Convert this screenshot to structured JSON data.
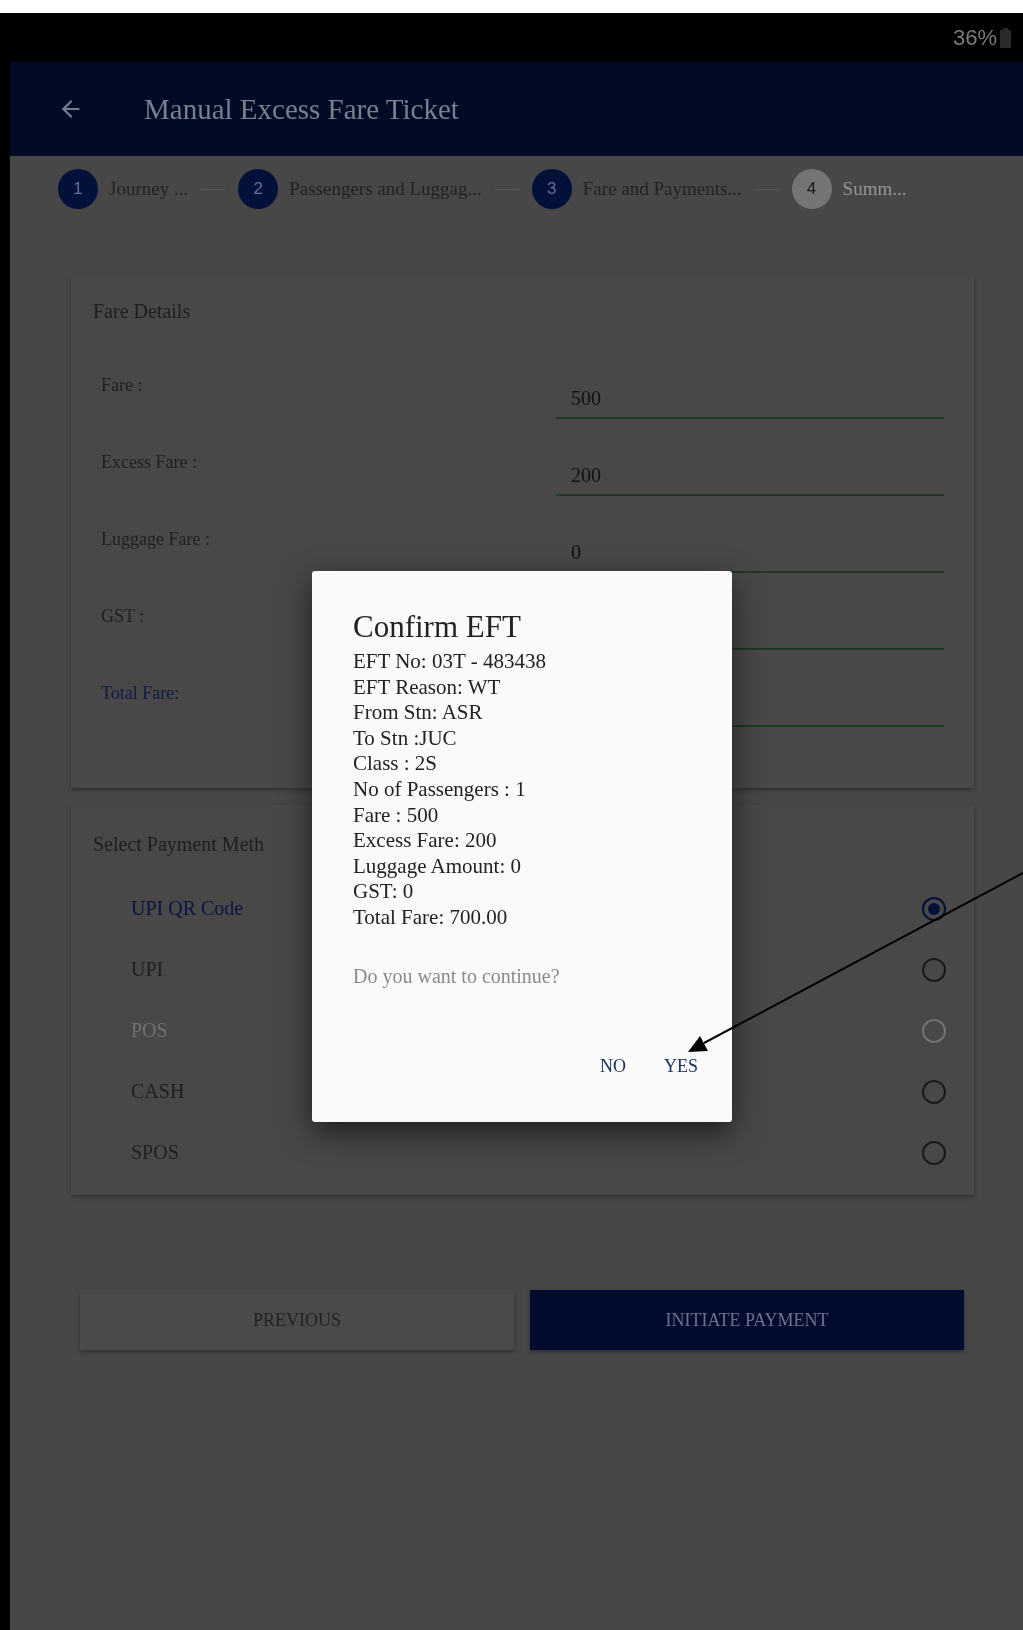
{
  "status_bar": {
    "battery": "36%"
  },
  "app_bar": {
    "title": "Manual Excess Fare Ticket"
  },
  "steps": [
    {
      "number": "1",
      "label": "Journey ...",
      "active": true
    },
    {
      "number": "2",
      "label": "Passengers and Luggag...",
      "active": true
    },
    {
      "number": "3",
      "label": "Fare and Payments...",
      "active": true
    },
    {
      "number": "4",
      "label": "Summ...",
      "active": false
    }
  ],
  "fare_details": {
    "title": "Fare Details",
    "rows": [
      {
        "label": "Fare :",
        "value": "500",
        "highlighted": false
      },
      {
        "label": "Excess Fare :",
        "value": "200",
        "highlighted": false
      },
      {
        "label": "Luggage Fare :",
        "value": "0",
        "highlighted": false
      },
      {
        "label": "GST :",
        "highlighted": false
      },
      {
        "label": "Total Fare:",
        "highlighted": true
      }
    ]
  },
  "payment": {
    "title": "Select Payment Meth",
    "methods": [
      {
        "label": "UPI QR Code",
        "selected": true,
        "disabled": false
      },
      {
        "label": "UPI",
        "selected": false,
        "disabled": false
      },
      {
        "label": "POS",
        "selected": false,
        "disabled": true
      },
      {
        "label": "CASH",
        "selected": false,
        "disabled": false
      },
      {
        "label": "SPOS",
        "selected": false,
        "disabled": false
      }
    ]
  },
  "buttons": [
    {
      "label": "PREVIOUS",
      "kind": "secondary"
    },
    {
      "label": "INITIATE PAYMENT",
      "kind": "primary"
    }
  ],
  "dialog": {
    "title": "Confirm EFT",
    "lines": [
      "EFT No: 03T - 483438",
      "EFT Reason: WT",
      "From Stn: ASR",
      "To Stn :JUC",
      "Class : 2S",
      "No of Passengers : 1",
      "Fare : 500",
      "Excess Fare: 200",
      "Luggage Amount: 0",
      "GST: 0",
      "Total Fare: 700.00"
    ],
    "question": "Do you want to continue?",
    "actions": [
      "NO",
      "YES"
    ]
  }
}
